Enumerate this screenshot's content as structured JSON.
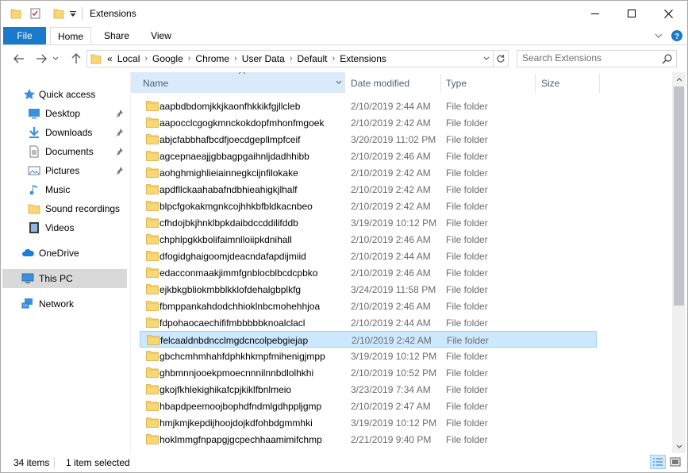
{
  "window": {
    "title": "Extensions",
    "controls": {
      "minimize": "minimize-icon",
      "maximize": "maximize-icon",
      "close": "close-icon"
    }
  },
  "ribbon": {
    "tabs": [
      {
        "label": "File"
      },
      {
        "label": "Home"
      },
      {
        "label": "Share"
      },
      {
        "label": "View"
      }
    ],
    "active_tab": "Home",
    "file_tab_color": "#1979ca"
  },
  "address": {
    "overflow": "«",
    "crumbs": [
      "Local",
      "Google",
      "Chrome",
      "User Data",
      "Default",
      "Extensions"
    ]
  },
  "search": {
    "placeholder": "Search Extensions"
  },
  "nav": {
    "quick_access": "Quick access",
    "pinned": [
      {
        "label": "Desktop",
        "icon": "desktop-icon"
      },
      {
        "label": "Downloads",
        "icon": "downloads-icon"
      },
      {
        "label": "Documents",
        "icon": "documents-icon"
      },
      {
        "label": "Pictures",
        "icon": "pictures-icon"
      }
    ],
    "other": [
      {
        "label": "Music",
        "icon": "music-icon"
      },
      {
        "label": "Sound recordings",
        "icon": "folder-icon"
      },
      {
        "label": "Videos",
        "icon": "videos-icon"
      }
    ],
    "onedrive": "OneDrive",
    "this_pc": "This PC",
    "network": "Network",
    "selected": "This PC"
  },
  "columns": {
    "name": "Name",
    "date": "Date modified",
    "type": "Type",
    "size": "Size"
  },
  "files": [
    {
      "name": "aapbdbdomjkkjkaonfhkkikfgjllcleb",
      "date": "2/10/2019 2:44 AM",
      "type": "File folder"
    },
    {
      "name": "aapocclcgogkmnckokdopfmhonfmgoek",
      "date": "2/10/2019 2:42 AM",
      "type": "File folder"
    },
    {
      "name": "abjcfabbhafbcdfjoecdgepllmpfceif",
      "date": "3/20/2019 11:02 PM",
      "type": "File folder"
    },
    {
      "name": "agcepnaeajjgbbagpgaihnljdadhhibb",
      "date": "2/10/2019 2:46 AM",
      "type": "File folder"
    },
    {
      "name": "aohghmighlieiainnegkcijnfilokake",
      "date": "2/10/2019 2:42 AM",
      "type": "File folder"
    },
    {
      "name": "apdfllckaahabafndbhieahigkjlhalf",
      "date": "2/10/2019 2:42 AM",
      "type": "File folder"
    },
    {
      "name": "blpcfgokakmgnkcojhhkbfbldkacnbeo",
      "date": "2/10/2019 2:42 AM",
      "type": "File folder"
    },
    {
      "name": "cfhdojbkjhnklbpkdaibdccddilifddb",
      "date": "3/19/2019 10:12 PM",
      "type": "File folder"
    },
    {
      "name": "chphlpgkkbolifaimnlloiipkdnihall",
      "date": "2/10/2019 2:46 AM",
      "type": "File folder"
    },
    {
      "name": "dfogidghaigoomjdeacndafapdijmiid",
      "date": "2/10/2019 2:44 AM",
      "type": "File folder"
    },
    {
      "name": "edacconmaakjimmfgnblocblbcdcpbko",
      "date": "2/10/2019 2:46 AM",
      "type": "File folder"
    },
    {
      "name": "ejkbkgbliokmbblkklofdehalgbplkfg",
      "date": "3/24/2019 11:58 PM",
      "type": "File folder"
    },
    {
      "name": "fbmppankahdodchhioklnbcmohehhjoa",
      "date": "2/10/2019 2:46 AM",
      "type": "File folder"
    },
    {
      "name": "fdpohaocaechififmbbbbbknoalclacl",
      "date": "2/10/2019 2:44 AM",
      "type": "File folder"
    },
    {
      "name": "felcaaldnbdncclmgdcncolpebgiejap",
      "date": "2/10/2019 2:42 AM",
      "type": "File folder"
    },
    {
      "name": "gbchcmhmhahfdphkhkmpfmihenigjmpp",
      "date": "3/19/2019 10:12 PM",
      "type": "File folder"
    },
    {
      "name": "ghbmnnjooekpmoecnnnilnnbdlolhkhi",
      "date": "2/10/2019 10:52 PM",
      "type": "File folder"
    },
    {
      "name": "gkojfkhlekighikafcpjkiklfbnlmeio",
      "date": "3/23/2019 7:34 AM",
      "type": "File folder"
    },
    {
      "name": "hbapdpeemoojbophdfndmlgdhppljgmp",
      "date": "2/10/2019 2:47 AM",
      "type": "File folder"
    },
    {
      "name": "hmjkmjkepdijhoojdojkdfohbdgmmhki",
      "date": "3/19/2019 10:12 PM",
      "type": "File folder"
    },
    {
      "name": "hoklmmgfnpapgjgcpechhaamimifchmp",
      "date": "2/21/2019 9:40 PM",
      "type": "File folder"
    }
  ],
  "selected_file": "felcaaldnbdncclmgdcncolpebgiejap",
  "status": {
    "items": "34 items",
    "selected": "1 item selected"
  },
  "colors": {
    "selection_bg": "#cce8ff",
    "selection_border": "#99d1ff",
    "header_sorted_bg": "#d9ebf9",
    "folder": "#f8d775"
  }
}
